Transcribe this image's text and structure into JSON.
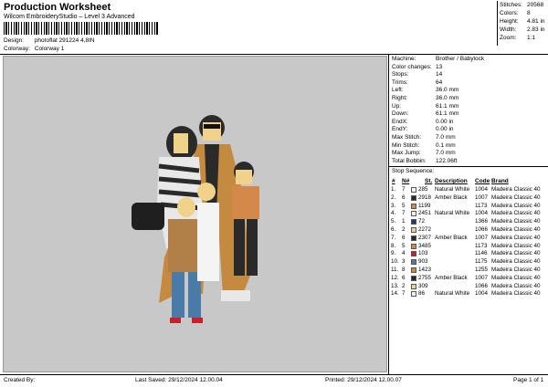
{
  "header": {
    "title": "Production Worksheet",
    "subtitle": "Wilcom EmbroideryStudio – Level 3 Advanced",
    "design_label": "Design:",
    "design_value": "photoflat 291224 4,8IN",
    "colorway_label": "Colorway:",
    "colorway_value": "Colorway 1"
  },
  "stats": [
    {
      "label": "Stitches:",
      "value": "20568"
    },
    {
      "label": "Colors:",
      "value": "8"
    },
    {
      "label": "Height:",
      "value": "4.81 in"
    },
    {
      "label": "Width:",
      "value": "2.83 in"
    },
    {
      "label": "Zoom:",
      "value": "1:1"
    }
  ],
  "machine_info": [
    {
      "label": "Machine:",
      "value": "Brother / Babylock"
    },
    {
      "label": "Color changes:",
      "value": "13"
    },
    {
      "label": "Stops:",
      "value": "14"
    },
    {
      "label": "Trims:",
      "value": "64"
    },
    {
      "label": "Left:",
      "value": "36.0 mm"
    },
    {
      "label": "Right:",
      "value": "36.0 mm"
    },
    {
      "label": "Up:",
      "value": "61.1 mm"
    },
    {
      "label": "Down:",
      "value": "61.1 mm"
    },
    {
      "label": "EndX:",
      "value": "0.00 in"
    },
    {
      "label": "EndY:",
      "value": "0.00 in"
    },
    {
      "label": "Max Stitch:",
      "value": "7.0 mm"
    },
    {
      "label": "Min Stitch:",
      "value": "0.1 mm"
    },
    {
      "label": "Max Jump:",
      "value": "7.0 mm"
    },
    {
      "label": "Total Bobbin:",
      "value": "122.06ft"
    }
  ],
  "sequence": {
    "title": "Stop Sequence:",
    "headers": {
      "num": "#",
      "n": "N#",
      "st": "St.",
      "desc": "Description",
      "code": "Code",
      "brand": "Brand"
    },
    "rows": [
      {
        "num": "1.",
        "n": "7",
        "color": "#f4f4f4",
        "st": "285",
        "desc": "Natural White",
        "code": "1004",
        "brand": "Madeira Classic 40"
      },
      {
        "num": "2.",
        "n": "6",
        "color": "#2a2a2a",
        "st": "2918",
        "desc": "Amber Black",
        "code": "1007",
        "brand": "Madeira Classic 40"
      },
      {
        "num": "3.",
        "n": "5",
        "color": "#d4894a",
        "st": "1199",
        "desc": "",
        "code": "1173",
        "brand": "Madeira Classic 40"
      },
      {
        "num": "4.",
        "n": "7",
        "color": "#f4f4f4",
        "st": "2451",
        "desc": "Natural White",
        "code": "1004",
        "brand": "Madeira Classic 40"
      },
      {
        "num": "5.",
        "n": "1",
        "color": "#1f3a7a",
        "st": "72",
        "desc": "",
        "code": "1366",
        "brand": "Madeira Classic 40"
      },
      {
        "num": "6.",
        "n": "2",
        "color": "#f0d28a",
        "st": "2272",
        "desc": "",
        "code": "1066",
        "brand": "Madeira Classic 40"
      },
      {
        "num": "7.",
        "n": "6",
        "color": "#2a2a2a",
        "st": "2307",
        "desc": "Amber Black",
        "code": "1007",
        "brand": "Madeira Classic 40"
      },
      {
        "num": "8.",
        "n": "5",
        "color": "#d4894a",
        "st": "3485",
        "desc": "",
        "code": "1173",
        "brand": "Madeira Classic 40"
      },
      {
        "num": "9.",
        "n": "4",
        "color": "#c8202a",
        "st": "103",
        "desc": "",
        "code": "1146",
        "brand": "Madeira Classic 40"
      },
      {
        "num": "10.",
        "n": "3",
        "color": "#4a7aa8",
        "st": "903",
        "desc": "",
        "code": "1175",
        "brand": "Madeira Classic 40"
      },
      {
        "num": "11.",
        "n": "8",
        "color": "#c48a40",
        "st": "1423",
        "desc": "",
        "code": "1255",
        "brand": "Madeira Classic 40"
      },
      {
        "num": "12.",
        "n": "6",
        "color": "#2a2a2a",
        "st": "2755",
        "desc": "Amber Black",
        "code": "1007",
        "brand": "Madeira Classic 40"
      },
      {
        "num": "13.",
        "n": "2",
        "color": "#f0d28a",
        "st": "309",
        "desc": "",
        "code": "1066",
        "brand": "Madeira Classic 40"
      },
      {
        "num": "14.",
        "n": "7",
        "color": "#f4f4f4",
        "st": "86",
        "desc": "Natural White",
        "code": "1004",
        "brand": "Madeira Classic 40"
      }
    ]
  },
  "footer": {
    "created_by": "Created By:",
    "last_saved": "Last Saved: 29/12/2024 12.00.04",
    "printed": "Printed: 29/12/2024 12.00.07",
    "page": "Page 1 of 1"
  }
}
